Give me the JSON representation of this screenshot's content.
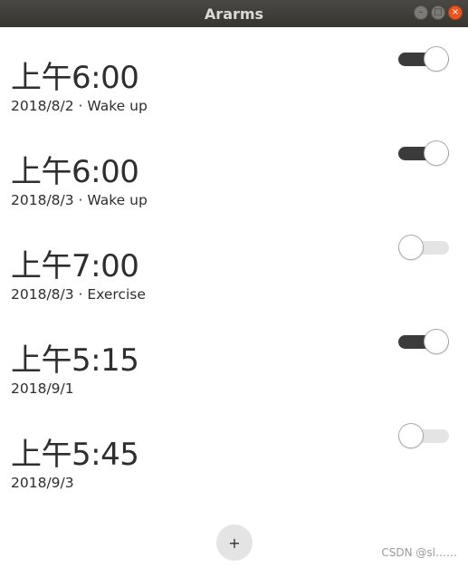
{
  "window": {
    "title": "Ararms",
    "controls": {
      "minimize_glyph": "–",
      "maximize_glyph": "□",
      "close_glyph": "×"
    }
  },
  "alarms": [
    {
      "time": "上午6:00",
      "subtitle": "2018/8/2 · Wake up",
      "enabled": true
    },
    {
      "time": "上午6:00",
      "subtitle": "2018/8/3 · Wake up",
      "enabled": true
    },
    {
      "time": "上午7:00",
      "subtitle": "2018/8/3 · Exercise",
      "enabled": false
    },
    {
      "time": "上午5:15",
      "subtitle": "2018/9/1",
      "enabled": true
    },
    {
      "time": "上午5:45",
      "subtitle": "2018/9/3",
      "enabled": false
    }
  ],
  "add_button": {
    "label": "+"
  },
  "watermark": "CSDN @sl……",
  "colors": {
    "titlebar": "#3c3b37",
    "switch_on": "#3b3b3b",
    "switch_off": "#e4e4e4",
    "close_button": "#e9541f"
  }
}
